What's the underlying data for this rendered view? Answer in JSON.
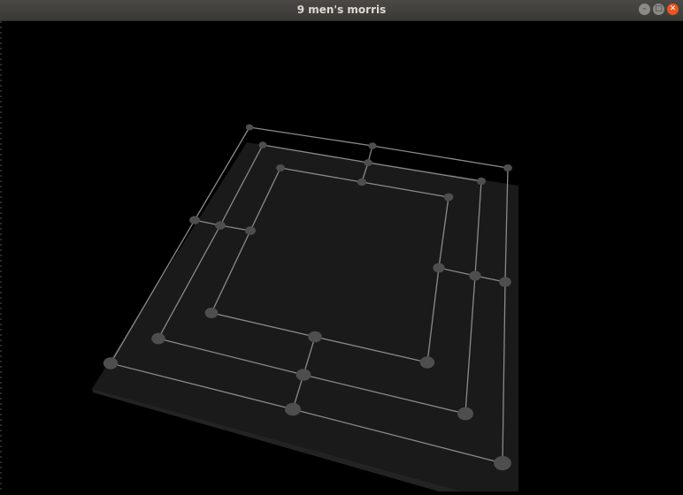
{
  "window": {
    "title": "9 men's morris",
    "controls": {
      "minimize": "–",
      "maximize": "□",
      "close": "✕"
    }
  },
  "board": {
    "colors": {
      "board_top": "#1a1a1a",
      "board_side": "#232323",
      "line": "#8a8a8a",
      "point": "#4e4e4e"
    }
  }
}
